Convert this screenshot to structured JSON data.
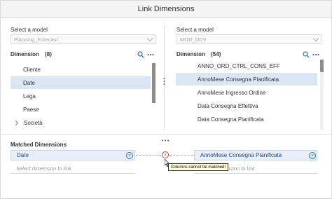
{
  "dialog": {
    "title": "Link Dimensions"
  },
  "left": {
    "model_label": "Select a model",
    "model_value": "Planning_Forecast",
    "dimension_heading": "Dimension",
    "dimension_count": "(8)",
    "items": [
      {
        "label": "Cliente"
      },
      {
        "label": "Date",
        "selected": true
      },
      {
        "label": "Lega"
      },
      {
        "label": "Paese"
      },
      {
        "label": "Società",
        "expandable": true
      }
    ]
  },
  "right": {
    "model_label": "Select a model",
    "model_value": "MOD_ODV",
    "dimension_heading": "Dimension",
    "dimension_count": "(54)",
    "items": [
      {
        "label": "ANNO_ORD_CTRL_CONS_EFF"
      },
      {
        "label": "AnnoMese Consegna Pianificata",
        "selected": true
      },
      {
        "label": "AnnoMese Ingresso Ordine"
      },
      {
        "label": "Data Consegna Effettiva"
      },
      {
        "label": "Data Consegna Pianificata"
      }
    ]
  },
  "matched": {
    "heading": "Matched Dimensions",
    "left_value": "Date",
    "right_value": "AnnoMese Consegna Pianificata",
    "left_placeholder": "Select dimension to link",
    "right_placeholder": "Select dimension to link",
    "error_tooltip": "Columns cannot be matched!"
  },
  "icons": {
    "search": "search-icon",
    "more": "more-icon",
    "clear": "clear-icon",
    "error": "error-icon"
  },
  "colors": {
    "selected_row": "#dae6f3",
    "matched_field": "#e8eff7",
    "error": "#d63b3b",
    "accent": "#2e6fb5"
  }
}
